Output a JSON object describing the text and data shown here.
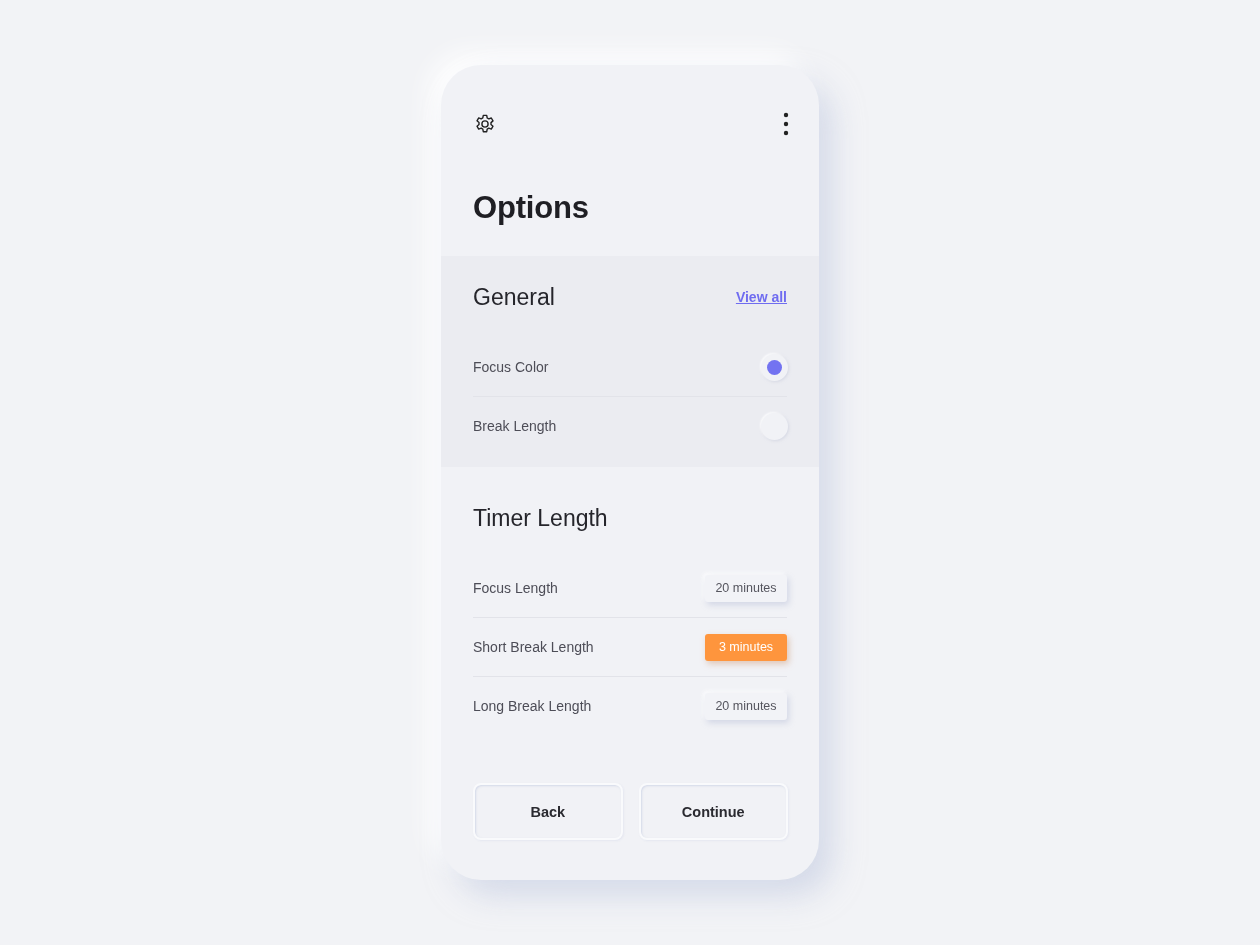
{
  "header": {
    "title": "Options"
  },
  "general": {
    "heading": "General",
    "link": "View all",
    "items": [
      {
        "label": "Focus Color",
        "on": true
      },
      {
        "label": "Break Length",
        "on": false
      }
    ]
  },
  "timer": {
    "heading": "Timer Length",
    "items": [
      {
        "label": "Focus Length",
        "value": "20 minutes",
        "selected": false
      },
      {
        "label": "Short Break Length",
        "value": "3 minutes",
        "selected": true
      },
      {
        "label": "Long Break Length",
        "value": "20 minutes",
        "selected": false
      }
    ]
  },
  "buttons": [
    "Back",
    "Continue"
  ]
}
